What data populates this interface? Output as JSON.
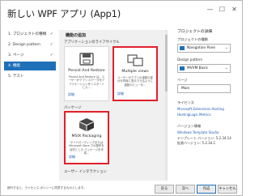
{
  "window": {
    "title": "新しい WPF アプリ (App1)",
    "controls": [
      "minimize-icon",
      "maximize-icon",
      "close-icon"
    ]
  },
  "nav": {
    "items": [
      {
        "label": "1. プロジェクトの種類",
        "done": true
      },
      {
        "label": "2. Design pattern",
        "done": true
      },
      {
        "label": "3. ページ",
        "done": true
      },
      {
        "label": "4. 機能",
        "done": false
      },
      {
        "label": "5. テスト",
        "done": false
      }
    ],
    "check": "✓"
  },
  "middle": {
    "title": "機能の追加",
    "section1": "アプリケーションのライフサイクル",
    "section2": "パッケージ",
    "section3": "ユーザー インタラクション",
    "cards": [
      {
        "name": "Persist And Restore",
        "desc": "Persist And Restore は、ユーザーがアプリ のデータをアプリケーションをリスタートした…",
        "link": "詳細"
      },
      {
        "name": "Multiple views",
        "desc": "ユーザーがアプリの複数の部分を同時に表示できるように複数のビューを…",
        "link": "詳細"
      },
      {
        "name": "MSIX Packaging",
        "desc": "サイドローディングまたは Microsoft Store での配布を目的とした パッケージを作成…",
        "link": "詳細"
      }
    ]
  },
  "right": {
    "heading": "プロジェクトの詳細",
    "project_type_label": "プロジェクトの種類",
    "project_type_value": "Navigation Pane",
    "design_pattern_label": "Design pattern",
    "design_pattern_value": "MVVM Basic",
    "pages_label": "ページ",
    "pages_value": "Main",
    "license_label": "ライセンス",
    "license_links": [
      "Microsoft.Extensions.Hosting",
      "HostingLogic.Metrics"
    ],
    "version_label": "バージョン情報",
    "version_link": "Windows Template Studio",
    "version_text1": "テンプレート バージョン: 5.2.34.14",
    "version_text2": "拡張バージョン: 5.2.34.1"
  },
  "footer": {
    "notice": "続行すると、ライセンス ポリシーに同意するものとします。",
    "buttons": [
      "戻る",
      "次へ",
      "作成",
      "キャンセル"
    ]
  },
  "colors": {
    "accent": "#1e70b8",
    "highlight": "#e0202a"
  }
}
